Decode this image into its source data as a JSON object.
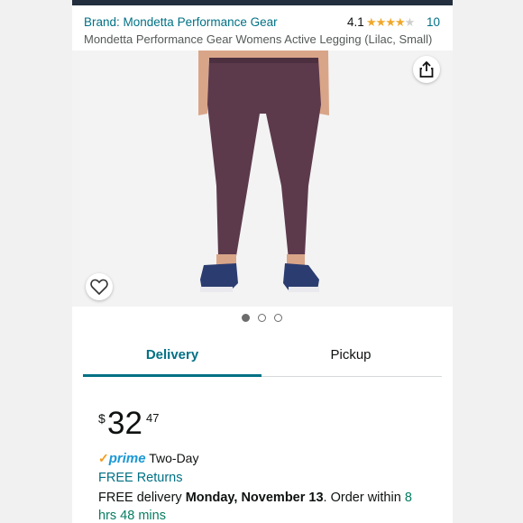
{
  "header": {
    "brand": "Brand: Mondetta Performance Gear",
    "rating": "4.1",
    "stars": {
      "full": 4,
      "total": 5
    },
    "rating_count": "10",
    "title": "Mondetta Performance Gear Womens Active Legging (Lilac, Small)"
  },
  "gallery": {
    "dot_count": 3,
    "active_dot": 0
  },
  "tabs": {
    "delivery": "Delivery",
    "pickup": "Pickup"
  },
  "price": {
    "symbol": "$",
    "whole": "32",
    "fraction": "47"
  },
  "shipping": {
    "check": "✓",
    "prime": "prime",
    "two_day": "Two-Day",
    "free_returns": "FREE Returns",
    "free_delivery": "FREE delivery",
    "date": "Monday, November 13",
    "order_within": ". Order within",
    "countdown": "8 hrs 48 mins"
  },
  "colors": {
    "link": "#007185",
    "star": "#f0a82b",
    "prime": "#1a98d5",
    "countdown": "#067d62",
    "legging": "#5c3a4c",
    "shoe": "#2b3c70"
  }
}
